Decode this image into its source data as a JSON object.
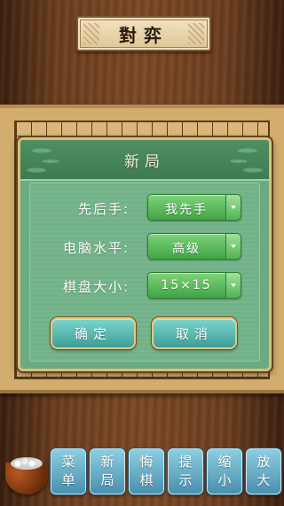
{
  "header": {
    "title": "對弈"
  },
  "dialog": {
    "title": "新局",
    "rows": [
      {
        "label": "先后手:",
        "value": "我先手"
      },
      {
        "label": "电脑水平:",
        "value": "高级"
      },
      {
        "label": "棋盘大小:",
        "value": "15×15"
      }
    ],
    "confirm_label": "确定",
    "cancel_label": "取消"
  },
  "toolbar": {
    "buttons": [
      {
        "line1": "菜",
        "line2": "单"
      },
      {
        "line1": "新",
        "line2": "局"
      },
      {
        "line1": "悔",
        "line2": "棋"
      },
      {
        "line1": "提",
        "line2": "示"
      },
      {
        "line1": "缩",
        "line2": "小"
      },
      {
        "line1": "放",
        "line2": "大"
      }
    ]
  },
  "colors": {
    "dialog_green": "#6cab82",
    "select_green": "#41a546",
    "button_teal": "#3e9e98",
    "tool_blue": "#4a8fae",
    "board_tan": "#d2ad6e"
  }
}
